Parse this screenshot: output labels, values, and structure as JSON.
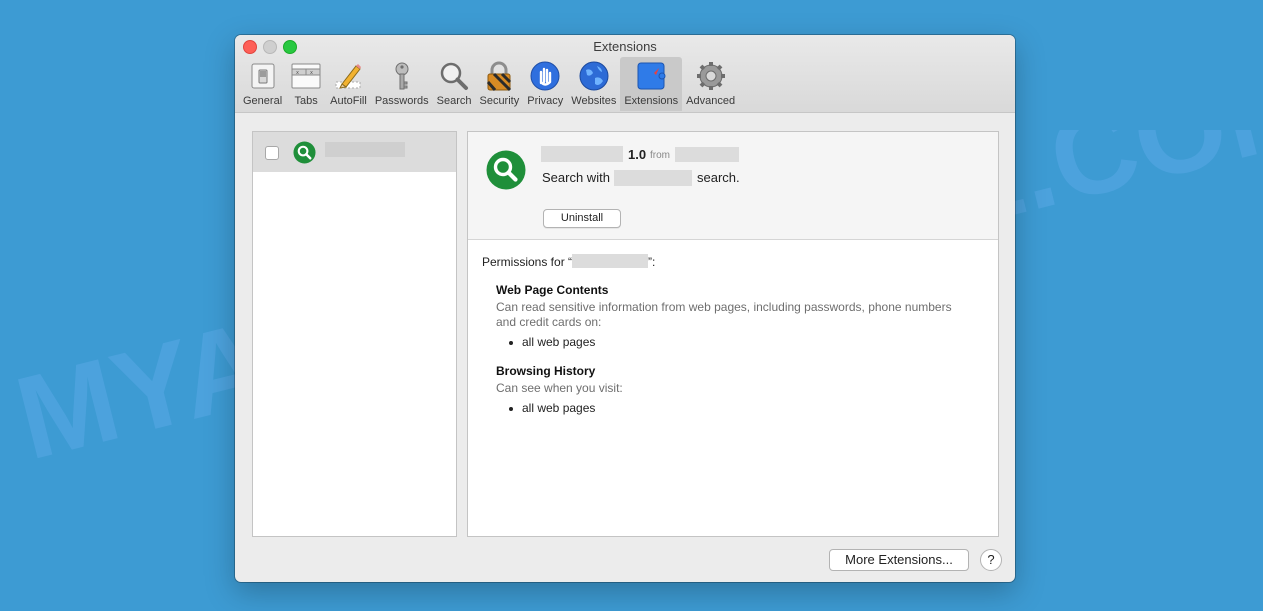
{
  "window": {
    "title": "Extensions"
  },
  "toolbar": {
    "tabs": [
      {
        "label": "General",
        "icon": "general-switch-icon"
      },
      {
        "label": "Tabs",
        "icon": "tabs-icon"
      },
      {
        "label": "AutoFill",
        "icon": "pencil-icon"
      },
      {
        "label": "Passwords",
        "icon": "key-icon"
      },
      {
        "label": "Search",
        "icon": "magnifier-icon"
      },
      {
        "label": "Security",
        "icon": "lock-icon"
      },
      {
        "label": "Privacy",
        "icon": "hand-icon"
      },
      {
        "label": "Websites",
        "icon": "globe-icon"
      },
      {
        "label": "Extensions",
        "icon": "puzzle-compass-icon"
      },
      {
        "label": "Advanced",
        "icon": "gear-icon"
      }
    ],
    "active_tab": "Extensions"
  },
  "extension": {
    "version": "1.0",
    "from_label": "from",
    "description_prefix": "Search with",
    "description_suffix": "search.",
    "uninstall_label": "Uninstall",
    "icon": "green-magnifier-icon",
    "icon_color": "#1f8f3a",
    "checked": false
  },
  "permissions": {
    "title_prefix": "Permissions for “",
    "title_suffix": "”:",
    "sections": [
      {
        "heading": "Web Page Contents",
        "description": "Can read sensitive information from web pages, including passwords, phone numbers and credit cards on:",
        "items": [
          "all web pages"
        ]
      },
      {
        "heading": "Browsing History",
        "description": "Can see when you visit:",
        "items": [
          "all web pages"
        ]
      }
    ]
  },
  "footer": {
    "more_extensions_label": "More Extensions...",
    "help_label": "?"
  },
  "watermark": {
    "text": "MYANTISPYWARE.COM"
  },
  "colors": {
    "desktop": "#3d9bd3",
    "window": "#ececec",
    "accent_blue": "#2f6fde"
  }
}
